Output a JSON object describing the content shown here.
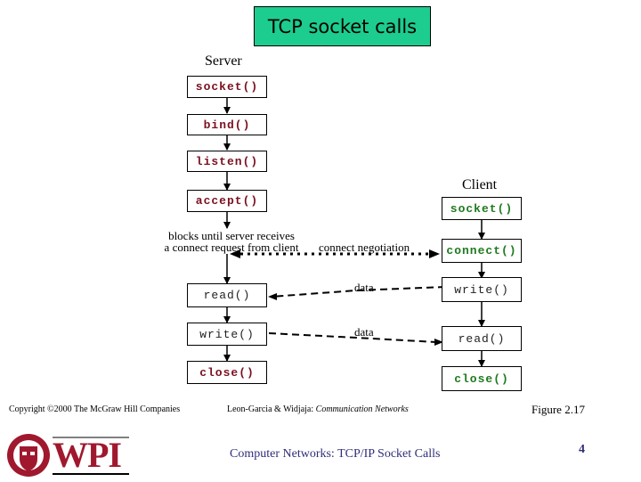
{
  "title": "TCP socket calls",
  "server": {
    "label": "Server",
    "calls": [
      "socket()",
      "bind()",
      "listen()",
      "accept()",
      "read()",
      "write()",
      "close()"
    ],
    "block_note_line1": "blocks until server receives",
    "block_note_line2": "a connect request from client"
  },
  "client": {
    "label": "Client",
    "calls": [
      "socket()",
      "connect()",
      "write()",
      "read()",
      "close()"
    ]
  },
  "arrows": {
    "connect_label": "connect negotiation",
    "data_label_1": "data",
    "data_label_2": "data"
  },
  "footer": {
    "copyright": "Copyright ©2000 The McGraw Hill Companies",
    "citation_authors": "Leon-Garcia & Widjaja:",
    "citation_book": "Communication Networks",
    "figure": "Figure 2.17",
    "course_title": "Computer Networks: TCP/IP Socket Calls",
    "page_number": "4",
    "logo_text": "WPI"
  },
  "colors": {
    "title_bg": "#1dcc8f",
    "server_call": "#7a1020",
    "client_call": "#1f7a1f",
    "footer_text": "#2e2e7a",
    "wpi_red": "#a0182e"
  }
}
